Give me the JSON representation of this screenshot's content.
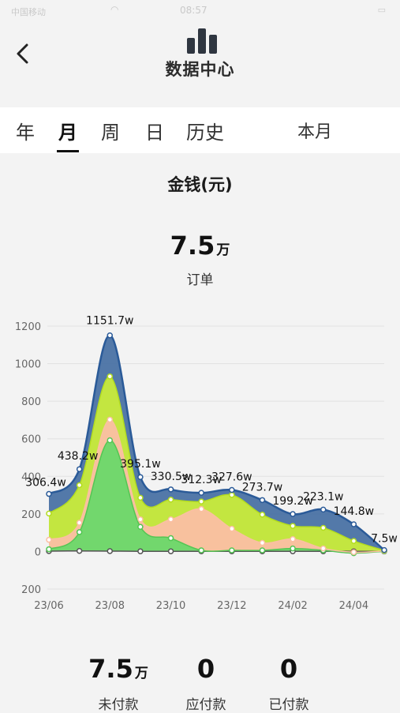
{
  "status_bar": {
    "carrier": "中国移动",
    "time": "08:57"
  },
  "header": {
    "title": "数据中心",
    "back_icon": "chevron-left-icon",
    "logo_icon": "bar-chart-icon"
  },
  "tabs": [
    {
      "label": "年",
      "active": false
    },
    {
      "label": "月",
      "active": true
    },
    {
      "label": "周",
      "active": false
    },
    {
      "label": "日",
      "active": false
    },
    {
      "label": "历史",
      "active": false
    }
  ],
  "period_label": "本月",
  "summary": {
    "title": "金钱(元)",
    "value": "7.5",
    "unit": "万",
    "label": "订单"
  },
  "chart_data": {
    "type": "area",
    "stacked": true,
    "x": [
      "23/06",
      "23/07",
      "23/08",
      "23/09",
      "23/10",
      "23/11",
      "23/12",
      "24/01",
      "24/02",
      "24/03",
      "24/04",
      "24/05"
    ],
    "xticks": [
      "23/06",
      "23/08",
      "23/10",
      "23/12",
      "24/02",
      "24/04"
    ],
    "ylim": [
      -200,
      1200
    ],
    "yticks": [
      -200,
      0,
      200,
      400,
      600,
      800,
      1000,
      1200
    ],
    "ytick_labels": [
      "200",
      "0",
      "200",
      "400",
      "600",
      "800",
      "1000",
      "1200"
    ],
    "grid": true,
    "series": [
      {
        "color": "#555555",
        "values": [
          2,
          3,
          2,
          1,
          1,
          1,
          1,
          1,
          1,
          1,
          1,
          0
        ]
      },
      {
        "color": "#6ad86a",
        "values": [
          10,
          100,
          590,
          130,
          70,
          5,
          5,
          5,
          15,
          5,
          -10,
          1
        ]
      },
      {
        "color": "#fbbfa3",
        "values": [
          50,
          50,
          110,
          40,
          100,
          220,
          115,
          40,
          50,
          10,
          5,
          2
        ]
      },
      {
        "color": "#c9ec3a",
        "values": [
          140,
          200,
          230,
          115,
          105,
          40,
          180,
          150,
          70,
          110,
          60,
          2
        ]
      },
      {
        "color": "#4a72a4",
        "values": [
          104.4,
          85.2,
          218.7,
          110.1,
          54.5,
          46.3,
          26.6,
          77.7,
          63.2,
          97.1,
          88.8,
          2.5
        ]
      }
    ],
    "total_labels": [
      "306.4w",
      "438.2w",
      "1151.7w",
      "395.1w",
      "330.5w",
      "312.3w",
      "327.6w",
      "273.7w",
      "199.2w",
      "223.1w",
      "144.8w",
      "7.5w"
    ]
  },
  "stats": [
    {
      "value": "7.5",
      "unit": "万",
      "label": "未付款"
    },
    {
      "value": "0",
      "unit": "",
      "label": "应付款"
    },
    {
      "value": "0",
      "unit": "",
      "label": "已付款"
    }
  ]
}
